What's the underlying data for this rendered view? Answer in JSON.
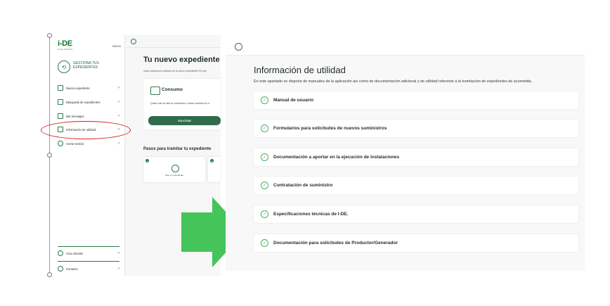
{
  "left_panel": {
    "logo": "i-DE",
    "logo_sub": "Grupo Iberdrola",
    "top_link": "INICIO",
    "section_title": "GESTIONA TUS EXPEDIENTES",
    "nav_items": [
      {
        "label": "Nuevo expediente",
        "icon": "file-plus-icon"
      },
      {
        "label": "Búsqueda de expedientes",
        "icon": "search-file-icon"
      },
      {
        "label": "Mis mensajes",
        "icon": "mail-icon"
      },
      {
        "label": "Información de utilidad",
        "icon": "info-folder-icon"
      },
      {
        "label": "Cerrar sesión",
        "icon": "logout-icon"
      }
    ],
    "bottom_items": [
      {
        "label": "Área clientes"
      },
      {
        "label": "Contacto"
      }
    ],
    "chevron": "›",
    "main": {
      "title": "Tu nuevo expediente",
      "subtitle": "¡Aquí empieza la solicitud de tu nuevo expediente! En prin",
      "consumo_title": "Consumo",
      "consumo_desc": "Quiero dar de alta un suministro o hacer cambios en e",
      "solicitar": "SOLICITAR",
      "pasos_title": "Pasos para tramitar tu expediente",
      "step_num_1": "1",
      "step_num_2": "2",
      "step_label_1": "Abre un expediente"
    }
  },
  "right_panel": {
    "title": "Información de utilidad",
    "description": "En este apartado se dispone de manuales de la aplicación así como de documentación adicional y de utilidad referente a la tramitación de expedientes de acometida.",
    "items": [
      "Manual de usuario",
      "Formularios para solicitudes de nuevos suministros",
      "Documentación a aportar en la ejecución de instalaciones",
      "Contratación de suministro",
      "Especificaciones técnicas de I-DE.",
      "Documentación para solicitudes de Productor/Generador"
    ]
  },
  "colors": {
    "brand_green": "#0e7a34",
    "arrow_green": "#45c45a",
    "highlight_red": "#d81e1e",
    "button_green": "#2f6b4c"
  }
}
